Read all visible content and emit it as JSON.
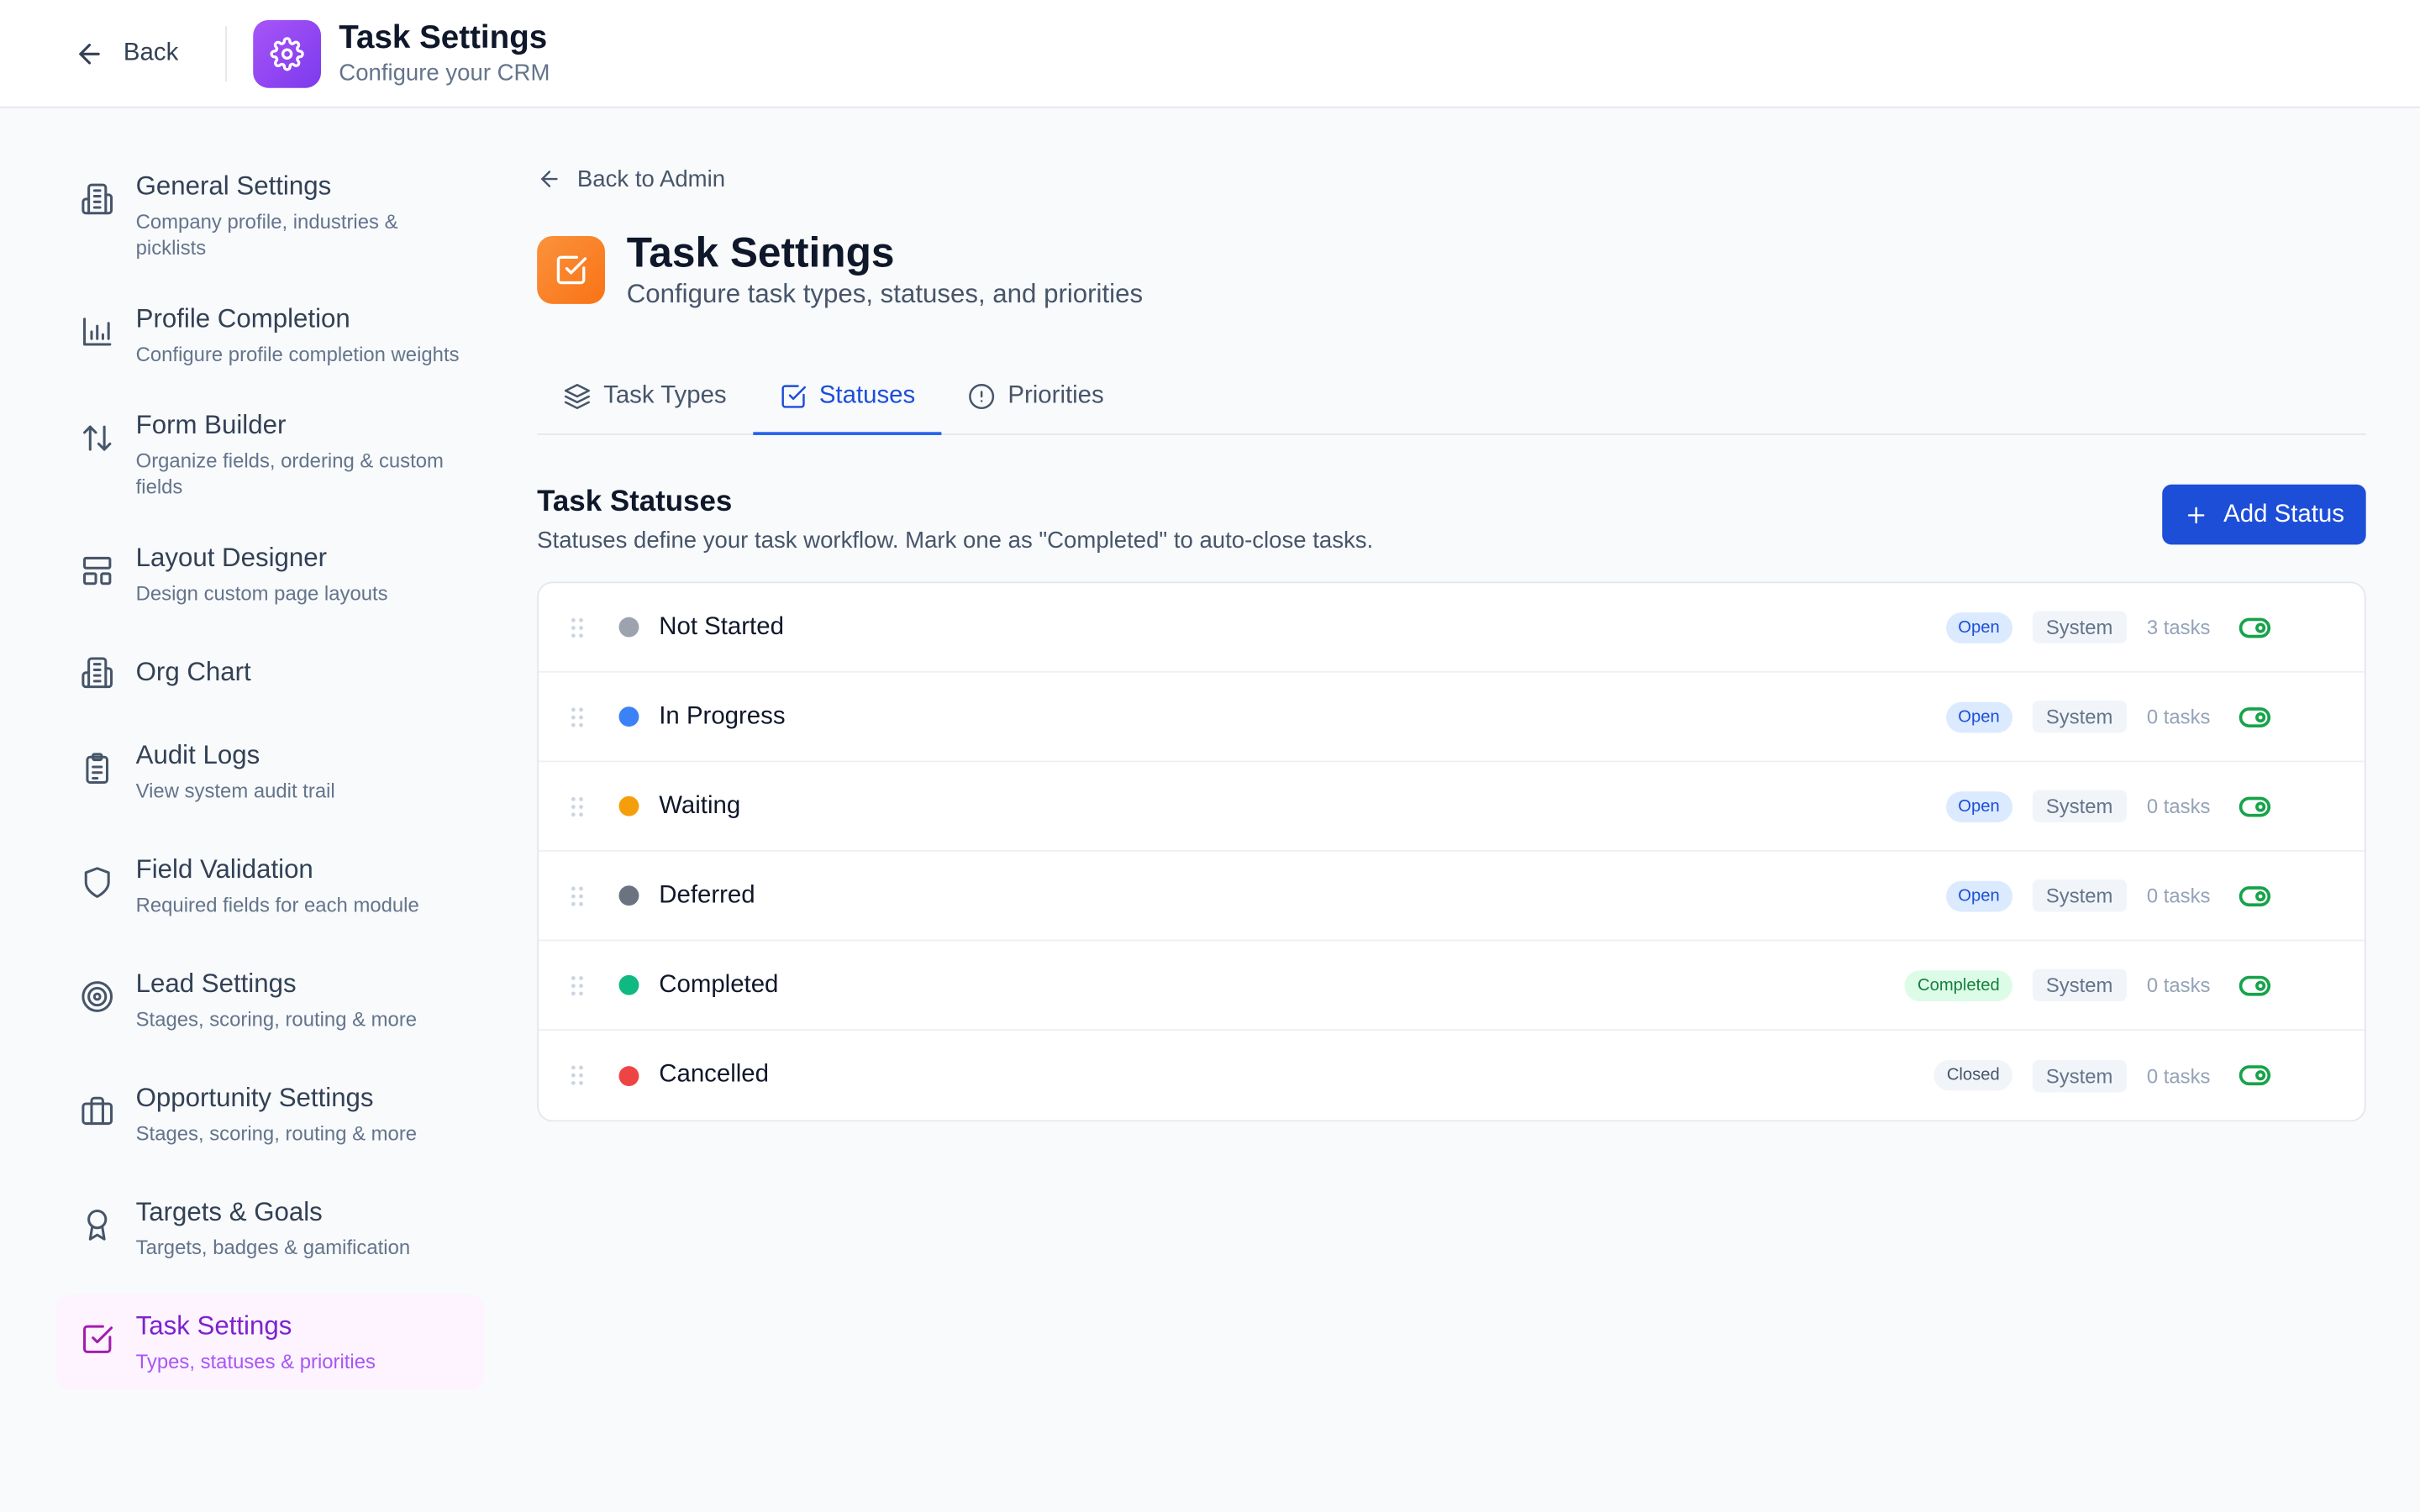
{
  "header": {
    "back_label": "Back",
    "title": "Task Settings",
    "subtitle": "Configure your CRM"
  },
  "sidebar": {
    "items": [
      {
        "label": "General Settings",
        "desc": "Company profile, industries & picklists",
        "icon": "building-icon"
      },
      {
        "label": "Profile Completion",
        "desc": "Configure profile completion weights",
        "icon": "bar-chart-icon"
      },
      {
        "label": "Form Builder",
        "desc": "Organize fields, ordering & custom fields",
        "icon": "sort-arrows-icon"
      },
      {
        "label": "Layout Designer",
        "desc": "Design custom page layouts",
        "icon": "layout-icon"
      },
      {
        "label": "Org Chart",
        "desc": "",
        "icon": "building-icon"
      },
      {
        "label": "Audit Logs",
        "desc": "View system audit trail",
        "icon": "clipboard-icon"
      },
      {
        "label": "Field Validation",
        "desc": "Required fields for each module",
        "icon": "shield-icon"
      },
      {
        "label": "Lead Settings",
        "desc": "Stages, scoring, routing & more",
        "icon": "target-icon"
      },
      {
        "label": "Opportunity Settings",
        "desc": "Stages, scoring, routing & more",
        "icon": "briefcase-icon"
      },
      {
        "label": "Targets & Goals",
        "desc": "Targets, badges & gamification",
        "icon": "award-icon"
      },
      {
        "label": "Task Settings",
        "desc": "Types, statuses & priorities",
        "icon": "check-square-icon"
      }
    ]
  },
  "main": {
    "back_admin": "Back to Admin",
    "title": "Task Settings",
    "subtitle": "Configure task types, statuses, and priorities",
    "tabs": [
      {
        "label": "Task Types",
        "icon": "layers-icon"
      },
      {
        "label": "Statuses",
        "icon": "check-square-icon"
      },
      {
        "label": "Priorities",
        "icon": "alert-circle-icon"
      }
    ],
    "section_title": "Task Statuses",
    "section_desc": "Statuses define your task workflow. Mark one as \"Completed\" to auto-close tasks.",
    "add_button": "Add Status",
    "statuses": [
      {
        "name": "Not Started",
        "color": "#9ca3af",
        "type": "Open",
        "badge": "System",
        "count": "3 tasks"
      },
      {
        "name": "In Progress",
        "color": "#3b82f6",
        "type": "Open",
        "badge": "System",
        "count": "0 tasks"
      },
      {
        "name": "Waiting",
        "color": "#f59e0b",
        "type": "Open",
        "badge": "System",
        "count": "0 tasks"
      },
      {
        "name": "Deferred",
        "color": "#6b7280",
        "type": "Open",
        "badge": "System",
        "count": "0 tasks"
      },
      {
        "name": "Completed",
        "color": "#10b981",
        "type": "Completed",
        "badge": "System",
        "count": "0 tasks"
      },
      {
        "name": "Cancelled",
        "color": "#ef4444",
        "type": "Closed",
        "badge": "System",
        "count": "0 tasks"
      }
    ]
  },
  "colors": {
    "accent": "#1d4ed8",
    "active_nav": "#7e22ce",
    "toggle_on": "#16a34a"
  }
}
